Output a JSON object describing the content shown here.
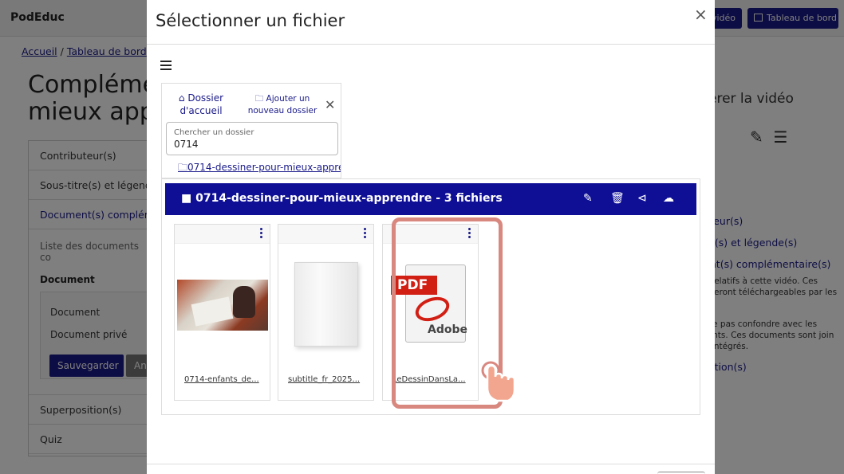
{
  "app": {
    "brand": "PodEduc",
    "top_buttons": {
      "video": "vidéo",
      "dashboard": "Tableau de bord"
    }
  },
  "breadcrumb": {
    "home": "Accueil",
    "dashboard": "Tableau de bord",
    "sep": "/"
  },
  "page": {
    "title_line1": "Compléme",
    "title_line2": "mieux app"
  },
  "accordion": {
    "contributors": "Contributeur(s)",
    "subtitles": "Sous-titre(s) et légende",
    "documents": "Document(s) complém",
    "list_text": "Liste des documents co",
    "document_header": "Document",
    "document_label": "Document",
    "private_label": "Document privé",
    "save": "Sauvegarder",
    "cancel": "Ann",
    "overlay": "Superposition(s)",
    "quiz": "Quiz"
  },
  "right_panel": {
    "title": "érer la vidéo",
    "links": [
      "ibuteur(s)",
      "titre(s) et légende(s)",
      "ment(s) complémentaire(s)"
    ],
    "text": [
      "t(s) relatifs à cette vidéo. Ces",
      "nts seront téléchargeables par les",
      "rs.",
      "",
      ", à ne pas confondre avec les",
      "ements. Ces documents sont join",
      "pas intégrés."
    ],
    "overlay_link": "position(s)"
  },
  "modal": {
    "title": "Sélectionner un fichier",
    "close": "×",
    "home_folder": "Dossier d'accueil",
    "add_folder": "Ajouter un nouveau dossier",
    "search_label": "Chercher un dossier",
    "search_value": "0714",
    "folder_result": "0714-dessiner-pour-mieux-appre",
    "current_folder": "0714-dessiner-pour-mieux-apprendre - 3 fichiers",
    "files": [
      {
        "name": "0714-enfants_de...",
        "type": "image"
      },
      {
        "name": "subtitle_fr_2025...",
        "type": "text"
      },
      {
        "name": "LeDessinDansLa...",
        "type": "pdf"
      }
    ],
    "pdf_label": "PDF",
    "pdf_brand": "Adobe"
  }
}
